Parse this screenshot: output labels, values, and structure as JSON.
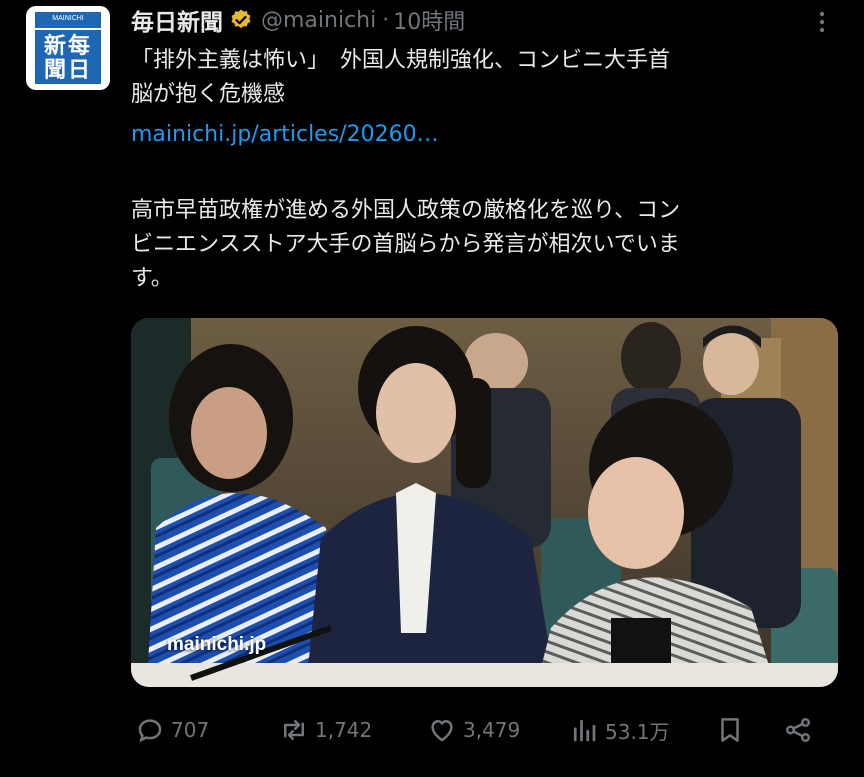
{
  "account": {
    "name": "毎日新聞",
    "handle": "@mainichi",
    "separator": "·",
    "time": "10時間",
    "logo_small": "MAINICHI",
    "logo_chars": "新每聞日"
  },
  "tweet": {
    "headline_line1": "「排外主義は怖い」　外国人規制強化、コンビニ大手首",
    "headline_line2": "脳が抱く危機感",
    "link": "mainichi.jp/articles/20260…",
    "para_line1": "高市早苗政権が進める外国人政策の厳格化を巡り、コン",
    "para_line2": "ビニエンスストア大手の首脳らから発言が相次いでいま",
    "para_line3": "す。"
  },
  "media": {
    "watermark": "mainichi.jp"
  },
  "actions": {
    "replies": "707",
    "reposts": "1,742",
    "likes": "3,479",
    "views": "53.1万"
  },
  "colors": {
    "background": "#000000",
    "text": "#e7e9ea",
    "muted": "#71767b",
    "link": "#1d9bf0",
    "verified": "#e8b830",
    "logo_blue": "#1f66b3"
  }
}
